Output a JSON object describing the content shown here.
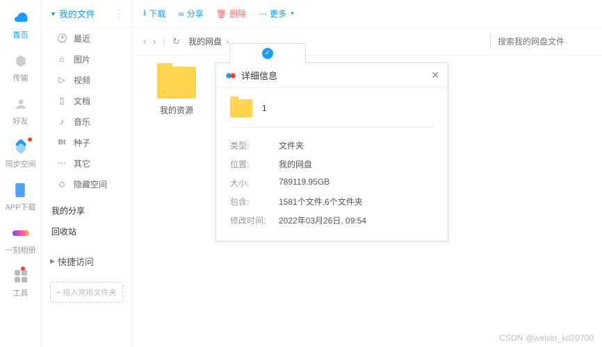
{
  "rail": {
    "items": [
      {
        "label": "首页",
        "icon": "cloud",
        "active": true
      },
      {
        "label": "传输",
        "icon": "hex"
      },
      {
        "label": "好友",
        "icon": "person"
      },
      {
        "label": "同步空间",
        "icon": "loop",
        "dot": true
      },
      {
        "label": "APP下载",
        "icon": "phone"
      },
      {
        "label": "一刻相册",
        "icon": "gradient"
      },
      {
        "label": "工具",
        "icon": "apps",
        "dot": true
      }
    ]
  },
  "sidebar": {
    "header": "我的文件",
    "items": [
      {
        "icon": "🕐",
        "label": "最近"
      },
      {
        "icon": "⌂",
        "label": "图片"
      },
      {
        "icon": "▷",
        "label": "视频"
      },
      {
        "icon": "▯",
        "label": "文档"
      },
      {
        "icon": "♪",
        "label": "音乐"
      },
      {
        "icon": "Bt",
        "label": "种子"
      },
      {
        "icon": "⋯",
        "label": "其它"
      },
      {
        "icon": "◇",
        "label": "隐藏空间"
      }
    ],
    "extra": [
      {
        "label": "我的分享"
      },
      {
        "label": "回收站"
      }
    ],
    "quick_header": "快捷访问",
    "quick_add": "+ 拖入常用文件夹"
  },
  "toolbar": {
    "download": "下载",
    "share": "分享",
    "delete": "删除",
    "more": "更多"
  },
  "nav": {
    "breadcrumb": "我的网盘",
    "search_placeholder": "搜索我的网盘文件"
  },
  "folder": {
    "name": "我的资源"
  },
  "detail": {
    "title": "详细信息",
    "file_name": "1",
    "rows": [
      {
        "key": "类型:",
        "val": "文件夹"
      },
      {
        "key": "位置:",
        "val": "我的网盘"
      },
      {
        "key": "大小:",
        "val": "789119.95GB"
      },
      {
        "key": "包含:",
        "val": "1581个文件,6个文件夹"
      },
      {
        "key": "修改时间:",
        "val": "2022年03月26日, 09:54"
      }
    ]
  },
  "watermark": "CSDN @weixin_kd20700"
}
